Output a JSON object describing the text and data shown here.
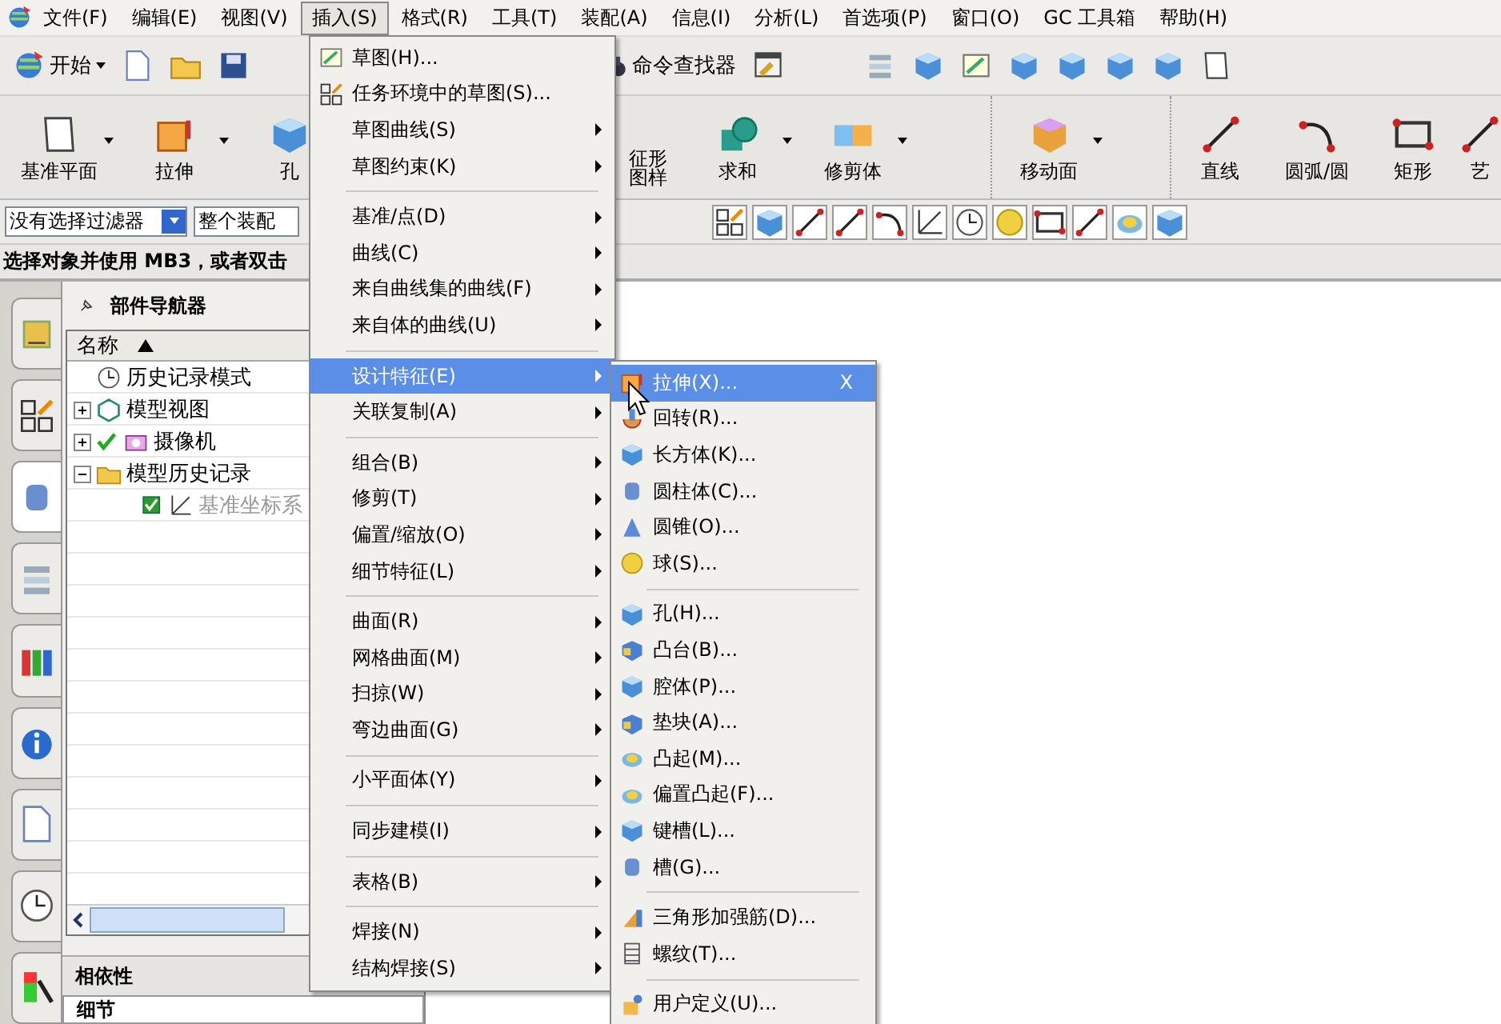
{
  "menubar": {
    "items": [
      {
        "label": "文件(F)",
        "selected": false
      },
      {
        "label": "编辑(E)",
        "selected": false
      },
      {
        "label": "视图(V)",
        "selected": false
      },
      {
        "label": "插入(S)",
        "selected": true
      },
      {
        "label": "格式(R)",
        "selected": false
      },
      {
        "label": "工具(T)",
        "selected": false
      },
      {
        "label": "装配(A)",
        "selected": false
      },
      {
        "label": "信息(I)",
        "selected": false
      },
      {
        "label": "分析(L)",
        "selected": false
      },
      {
        "label": "首选项(P)",
        "selected": false
      },
      {
        "label": "窗口(O)",
        "selected": false
      },
      {
        "label": "GC 工具箱",
        "selected": false
      },
      {
        "label": "帮助(H)",
        "selected": false
      }
    ]
  },
  "standard_toolbar": {
    "start_button": "开始",
    "command_finder": "命令查找器"
  },
  "feature_toolbar": {
    "buttons": [
      {
        "label": "基准平面",
        "has_dropdown": true
      },
      {
        "label": "拉伸",
        "has_dropdown": true
      },
      {
        "label": "孔"
      },
      {
        "label": "征形",
        "label_line_2": "图样",
        "has_dropdown": false
      },
      {
        "label": "求和",
        "has_dropdown": true
      },
      {
        "label": "修剪体",
        "has_dropdown": true
      },
      {
        "label": "移动面",
        "has_dropdown": true
      },
      {
        "label": "直线",
        "has_dropdown": false
      },
      {
        "label": "圆弧/圆",
        "has_dropdown": false
      },
      {
        "label": "矩形",
        "has_dropdown": false
      },
      {
        "label": "艺"
      }
    ]
  },
  "selection_bar": {
    "filter": "没有选择过滤器",
    "scope": "整个装配"
  },
  "status_line": "选择对象并使用 MB3，或者双击",
  "part_navigator": {
    "title": "部件导航器",
    "column": "名称",
    "tree": [
      {
        "label": "历史记录模式",
        "has_children": false,
        "checked": false,
        "greyed": false
      },
      {
        "label": "模型视图",
        "expanded": false,
        "has_children": true,
        "checked": false,
        "greyed": false
      },
      {
        "label": "摄像机",
        "expanded": false,
        "has_children": true,
        "checked": true,
        "greyed": false
      },
      {
        "label": "模型历史记录",
        "expanded": true,
        "has_children": true,
        "checked": false,
        "greyed": false,
        "children": [
          {
            "label": "基准坐标系",
            "has_children": false,
            "checked": true,
            "greyed": true
          }
        ]
      }
    ],
    "dependencies": "相依性",
    "details": "细节"
  },
  "insert_menu": {
    "items": [
      {
        "kind": "item",
        "label": "草图(H)...",
        "submenu": false,
        "selected": false
      },
      {
        "kind": "item",
        "label": "任务环境中的草图(S)...",
        "submenu": false,
        "selected": false
      },
      {
        "kind": "item",
        "label": "草图曲线(S)",
        "submenu": true,
        "selected": false
      },
      {
        "kind": "item",
        "label": "草图约束(K)",
        "submenu": true,
        "selected": false
      },
      {
        "kind": "separator"
      },
      {
        "kind": "item",
        "label": "基准/点(D)",
        "submenu": true,
        "selected": false
      },
      {
        "kind": "item",
        "label": "曲线(C)",
        "submenu": true,
        "selected": false
      },
      {
        "kind": "item",
        "label": "来自曲线集的曲线(F)",
        "submenu": true,
        "selected": false
      },
      {
        "kind": "item",
        "label": "来自体的曲线(U)",
        "submenu": true,
        "selected": false
      },
      {
        "kind": "separator"
      },
      {
        "kind": "item",
        "label": "设计特征(E)",
        "submenu": true,
        "selected": true
      },
      {
        "kind": "item",
        "label": "关联复制(A)",
        "submenu": true,
        "selected": false
      },
      {
        "kind": "separator"
      },
      {
        "kind": "item",
        "label": "组合(B)",
        "submenu": true,
        "selected": false
      },
      {
        "kind": "item",
        "label": "修剪(T)",
        "submenu": true,
        "selected": false
      },
      {
        "kind": "item",
        "label": "偏置/缩放(O)",
        "submenu": true,
        "selected": false
      },
      {
        "kind": "item",
        "label": "细节特征(L)",
        "submenu": true,
        "selected": false
      },
      {
        "kind": "separator"
      },
      {
        "kind": "item",
        "label": "曲面(R)",
        "submenu": true,
        "selected": false
      },
      {
        "kind": "item",
        "label": "网格曲面(M)",
        "submenu": true,
        "selected": false
      },
      {
        "kind": "item",
        "label": "扫掠(W)",
        "submenu": true,
        "selected": false
      },
      {
        "kind": "item",
        "label": "弯边曲面(G)",
        "submenu": true,
        "selected": false
      },
      {
        "kind": "separator"
      },
      {
        "kind": "item",
        "label": "小平面体(Y)",
        "submenu": true,
        "selected": false
      },
      {
        "kind": "separator"
      },
      {
        "kind": "item",
        "label": "同步建模(I)",
        "submenu": true,
        "selected": false
      },
      {
        "kind": "separator"
      },
      {
        "kind": "item",
        "label": "表格(B)",
        "submenu": true,
        "selected": false
      },
      {
        "kind": "separator"
      },
      {
        "kind": "item",
        "label": "焊接(N)",
        "submenu": true,
        "selected": false
      },
      {
        "kind": "item",
        "label": "结构焊接(S)",
        "submenu": true,
        "selected": false
      }
    ]
  },
  "design_feature_menu": {
    "items": [
      {
        "kind": "item",
        "label": "拉伸(X)...",
        "shortcut": "X",
        "selected": true
      },
      {
        "kind": "item",
        "label": "回转(R)...",
        "selected": false
      },
      {
        "kind": "item",
        "label": "长方体(K)...",
        "selected": false
      },
      {
        "kind": "item",
        "label": "圆柱体(C)...",
        "selected": false
      },
      {
        "kind": "item",
        "label": "圆锥(O)...",
        "selected": false
      },
      {
        "kind": "item",
        "label": "球(S)...",
        "selected": false
      },
      {
        "kind": "separator"
      },
      {
        "kind": "item",
        "label": "孔(H)...",
        "selected": false
      },
      {
        "kind": "item",
        "label": "凸台(B)...",
        "selected": false
      },
      {
        "kind": "item",
        "label": "腔体(P)...",
        "selected": false
      },
      {
        "kind": "item",
        "label": "垫块(A)...",
        "selected": false
      },
      {
        "kind": "item",
        "label": "凸起(M)...",
        "selected": false
      },
      {
        "kind": "item",
        "label": "偏置凸起(F)...",
        "selected": false
      },
      {
        "kind": "item",
        "label": "键槽(L)...",
        "selected": false
      },
      {
        "kind": "item",
        "label": "槽(G)...",
        "selected": false
      },
      {
        "kind": "separator"
      },
      {
        "kind": "item",
        "label": "三角形加强筋(D)...",
        "selected": false
      },
      {
        "kind": "item",
        "label": "螺纹(T)...",
        "selected": false
      },
      {
        "kind": "separator"
      },
      {
        "kind": "item",
        "label": "用户定义(U)...",
        "selected": false
      }
    ]
  }
}
